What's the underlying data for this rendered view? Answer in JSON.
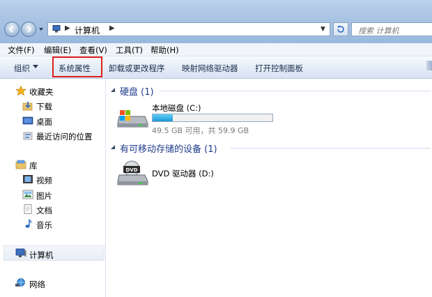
{
  "address": {
    "path": "计算机"
  },
  "search": {
    "placeholder": "搜索 计算机"
  },
  "menu": [
    {
      "label": "文件(F)"
    },
    {
      "label": "编辑(E)"
    },
    {
      "label": "查看(V)"
    },
    {
      "label": "工具(T)"
    },
    {
      "label": "帮助(H)"
    }
  ],
  "toolbar": {
    "organize": "组织",
    "system_properties": "系统属性",
    "uninstall": "卸载或更改程序",
    "map_drive": "映射网络驱动器",
    "control_panel": "打开控制面板"
  },
  "nav": {
    "favorites": "收藏夹",
    "downloads": "下载",
    "desktop": "桌面",
    "recent": "最近访问的位置",
    "libraries": "库",
    "videos": "视频",
    "pictures": "图片",
    "documents": "文档",
    "music": "音乐",
    "computer": "计算机",
    "network": "网络"
  },
  "groups": {
    "hdd": "硬盘 (1)",
    "removable": "有可移动存储的设备 (1)"
  },
  "drives": {
    "c": {
      "name": "本地磁盘 (C:)",
      "info": "49.5 GB 可用，共 59.9 GB",
      "used_fraction": 0.17
    },
    "dvd": {
      "name": "DVD 驱动器 (D:)",
      "icon_label": "DVD"
    }
  },
  "colors": {
    "highlight": "#e0201a",
    "group_header": "#1f3b8c",
    "bar_fill": "#1e97d6"
  }
}
